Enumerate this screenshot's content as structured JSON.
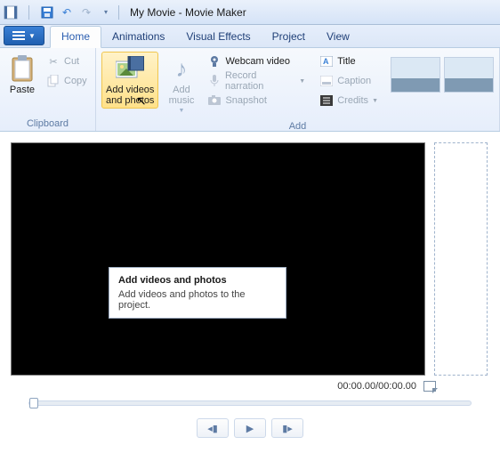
{
  "window": {
    "title": "My Movie - Movie Maker"
  },
  "tabs": {
    "home": "Home",
    "animations": "Animations",
    "visual_effects": "Visual Effects",
    "project": "Project",
    "view": "View"
  },
  "ribbon": {
    "clipboard": {
      "label": "Clipboard",
      "paste": "Paste",
      "cut": "Cut",
      "copy": "Copy"
    },
    "add_group": {
      "label": "Add",
      "add_videos": "Add videos and photos",
      "add_music": "Add music",
      "webcam": "Webcam video",
      "record": "Record narration",
      "snapshot": "Snapshot",
      "title": "Title",
      "caption": "Caption",
      "credits": "Credits"
    }
  },
  "tooltip": {
    "title": "Add videos and photos",
    "body": "Add videos and photos to the project."
  },
  "player": {
    "timecode": "00:00.00/00:00.00"
  }
}
